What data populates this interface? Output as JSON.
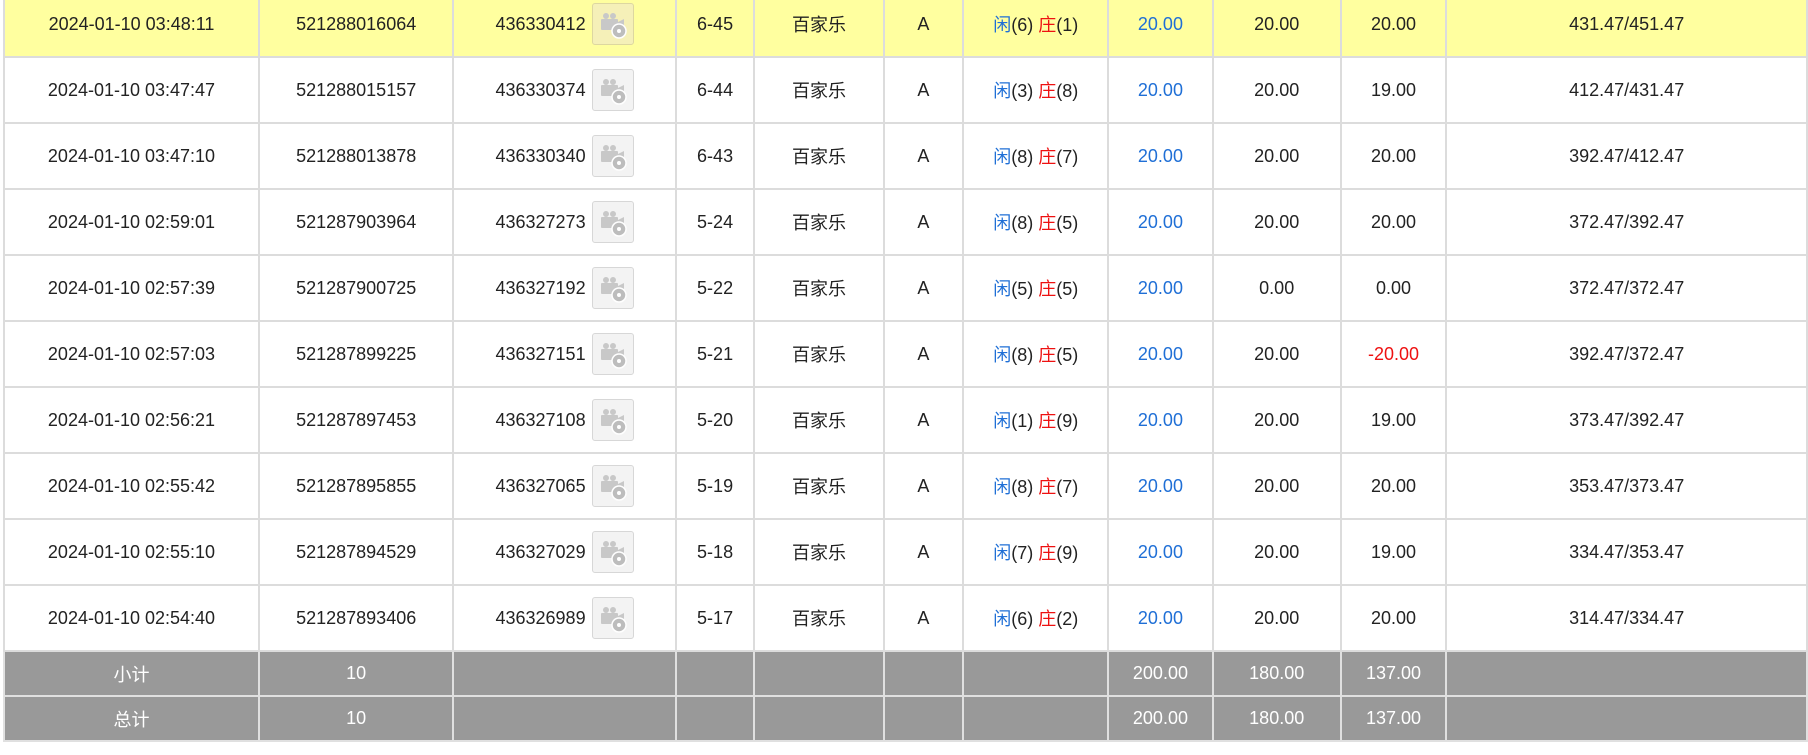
{
  "rows": [
    {
      "time": "2024-01-10 03:48:11",
      "order": "521288016064",
      "round": "436330412",
      "shoe": "6-45",
      "game": "百家乐",
      "table": "A",
      "player_label": "闲",
      "player_score": "(6)",
      "banker_label": "庄",
      "banker_score": "(1)",
      "bet": "20.00",
      "valid_bet": "20.00",
      "payout": "20.00",
      "balance": "431.47/451.47",
      "highlight": true,
      "payout_negative": false
    },
    {
      "time": "2024-01-10 03:47:47",
      "order": "521288015157",
      "round": "436330374",
      "shoe": "6-44",
      "game": "百家乐",
      "table": "A",
      "player_label": "闲",
      "player_score": "(3)",
      "banker_label": "庄",
      "banker_score": "(8)",
      "bet": "20.00",
      "valid_bet": "20.00",
      "payout": "19.00",
      "balance": "412.47/431.47",
      "highlight": false,
      "payout_negative": false
    },
    {
      "time": "2024-01-10 03:47:10",
      "order": "521288013878",
      "round": "436330340",
      "shoe": "6-43",
      "game": "百家乐",
      "table": "A",
      "player_label": "闲",
      "player_score": "(8)",
      "banker_label": "庄",
      "banker_score": "(7)",
      "bet": "20.00",
      "valid_bet": "20.00",
      "payout": "20.00",
      "balance": "392.47/412.47",
      "highlight": false,
      "payout_negative": false
    },
    {
      "time": "2024-01-10 02:59:01",
      "order": "521287903964",
      "round": "436327273",
      "shoe": "5-24",
      "game": "百家乐",
      "table": "A",
      "player_label": "闲",
      "player_score": "(8)",
      "banker_label": "庄",
      "banker_score": "(5)",
      "bet": "20.00",
      "valid_bet": "20.00",
      "payout": "20.00",
      "balance": "372.47/392.47",
      "highlight": false,
      "payout_negative": false
    },
    {
      "time": "2024-01-10 02:57:39",
      "order": "521287900725",
      "round": "436327192",
      "shoe": "5-22",
      "game": "百家乐",
      "table": "A",
      "player_label": "闲",
      "player_score": "(5)",
      "banker_label": "庄",
      "banker_score": "(5)",
      "bet": "20.00",
      "valid_bet": "0.00",
      "payout": "0.00",
      "balance": "372.47/372.47",
      "highlight": false,
      "payout_negative": false
    },
    {
      "time": "2024-01-10 02:57:03",
      "order": "521287899225",
      "round": "436327151",
      "shoe": "5-21",
      "game": "百家乐",
      "table": "A",
      "player_label": "闲",
      "player_score": "(8)",
      "banker_label": "庄",
      "banker_score": "(5)",
      "bet": "20.00",
      "valid_bet": "20.00",
      "payout": "-20.00",
      "balance": "392.47/372.47",
      "highlight": false,
      "payout_negative": true
    },
    {
      "time": "2024-01-10 02:56:21",
      "order": "521287897453",
      "round": "436327108",
      "shoe": "5-20",
      "game": "百家乐",
      "table": "A",
      "player_label": "闲",
      "player_score": "(1)",
      "banker_label": "庄",
      "banker_score": "(9)",
      "bet": "20.00",
      "valid_bet": "20.00",
      "payout": "19.00",
      "balance": "373.47/392.47",
      "highlight": false,
      "payout_negative": false
    },
    {
      "time": "2024-01-10 02:55:42",
      "order": "521287895855",
      "round": "436327065",
      "shoe": "5-19",
      "game": "百家乐",
      "table": "A",
      "player_label": "闲",
      "player_score": "(8)",
      "banker_label": "庄",
      "banker_score": "(7)",
      "bet": "20.00",
      "valid_bet": "20.00",
      "payout": "20.00",
      "balance": "353.47/373.47",
      "highlight": false,
      "payout_negative": false
    },
    {
      "time": "2024-01-10 02:55:10",
      "order": "521287894529",
      "round": "436327029",
      "shoe": "5-18",
      "game": "百家乐",
      "table": "A",
      "player_label": "闲",
      "player_score": "(7)",
      "banker_label": "庄",
      "banker_score": "(9)",
      "bet": "20.00",
      "valid_bet": "20.00",
      "payout": "19.00",
      "balance": "334.47/353.47",
      "highlight": false,
      "payout_negative": false
    },
    {
      "time": "2024-01-10 02:54:40",
      "order": "521287893406",
      "round": "436326989",
      "shoe": "5-17",
      "game": "百家乐",
      "table": "A",
      "player_label": "闲",
      "player_score": "(6)",
      "banker_label": "庄",
      "banker_score": "(2)",
      "bet": "20.00",
      "valid_bet": "20.00",
      "payout": "20.00",
      "balance": "314.47/334.47",
      "highlight": false,
      "payout_negative": false
    }
  ],
  "totals": [
    {
      "label": "小计",
      "count": "10",
      "bet": "200.00",
      "valid_bet": "180.00",
      "payout": "137.00"
    },
    {
      "label": "总计",
      "count": "10",
      "bet": "200.00",
      "valid_bet": "180.00",
      "payout": "137.00"
    }
  ],
  "colors": {
    "highlight_row": "#ffff9f",
    "total_row": "#999999",
    "player_blue": "#1f6fd6",
    "banker_red": "#ee1111",
    "negative_red": "#ee1111"
  },
  "icons": {
    "round_detail": "video-playback-icon"
  }
}
